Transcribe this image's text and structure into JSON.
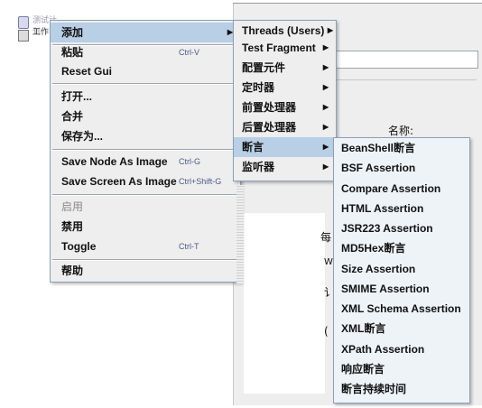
{
  "tree": {
    "root_label": "测试计划",
    "child_label": "工作台"
  },
  "background": {
    "name_label": "名称:",
    "fragments": [
      "每",
      "W",
      "讠",
      "("
    ]
  },
  "main_menu": {
    "add": "添加",
    "paste": "粘贴",
    "paste_shortcut": "Ctrl-V",
    "reset_gui": "Reset Gui",
    "open": "打开...",
    "merge": "合并",
    "save_as": "保存为...",
    "save_node_image": "Save Node As Image",
    "save_node_image_shortcut": "Ctrl-G",
    "save_screen_image": "Save Screen As Image",
    "save_screen_image_shortcut": "Ctrl+Shift-G",
    "enable": "启用",
    "disable": "禁用",
    "toggle": "Toggle",
    "toggle_shortcut": "Ctrl-T",
    "help": "帮助"
  },
  "add_submenu": {
    "items": [
      "Threads (Users)",
      "Test Fragment",
      "配置元件",
      "定时器",
      "前置处理器",
      "后置处理器",
      "断言",
      "监听器"
    ]
  },
  "assertion_submenu": {
    "items": [
      "BeanShell断言",
      "BSF Assertion",
      "Compare Assertion",
      "HTML Assertion",
      "JSR223 Assertion",
      "MD5Hex断言",
      "Size Assertion",
      "SMIME Assertion",
      "XML Schema Assertion",
      "XML断言",
      "XPath Assertion",
      "响应断言",
      "断言持续时间"
    ]
  },
  "colors": {
    "menu_bg": "#eeeeee",
    "highlight": "#b8cfe5",
    "border": "#8b9fb8",
    "shortcut": "#4a5a8a"
  }
}
